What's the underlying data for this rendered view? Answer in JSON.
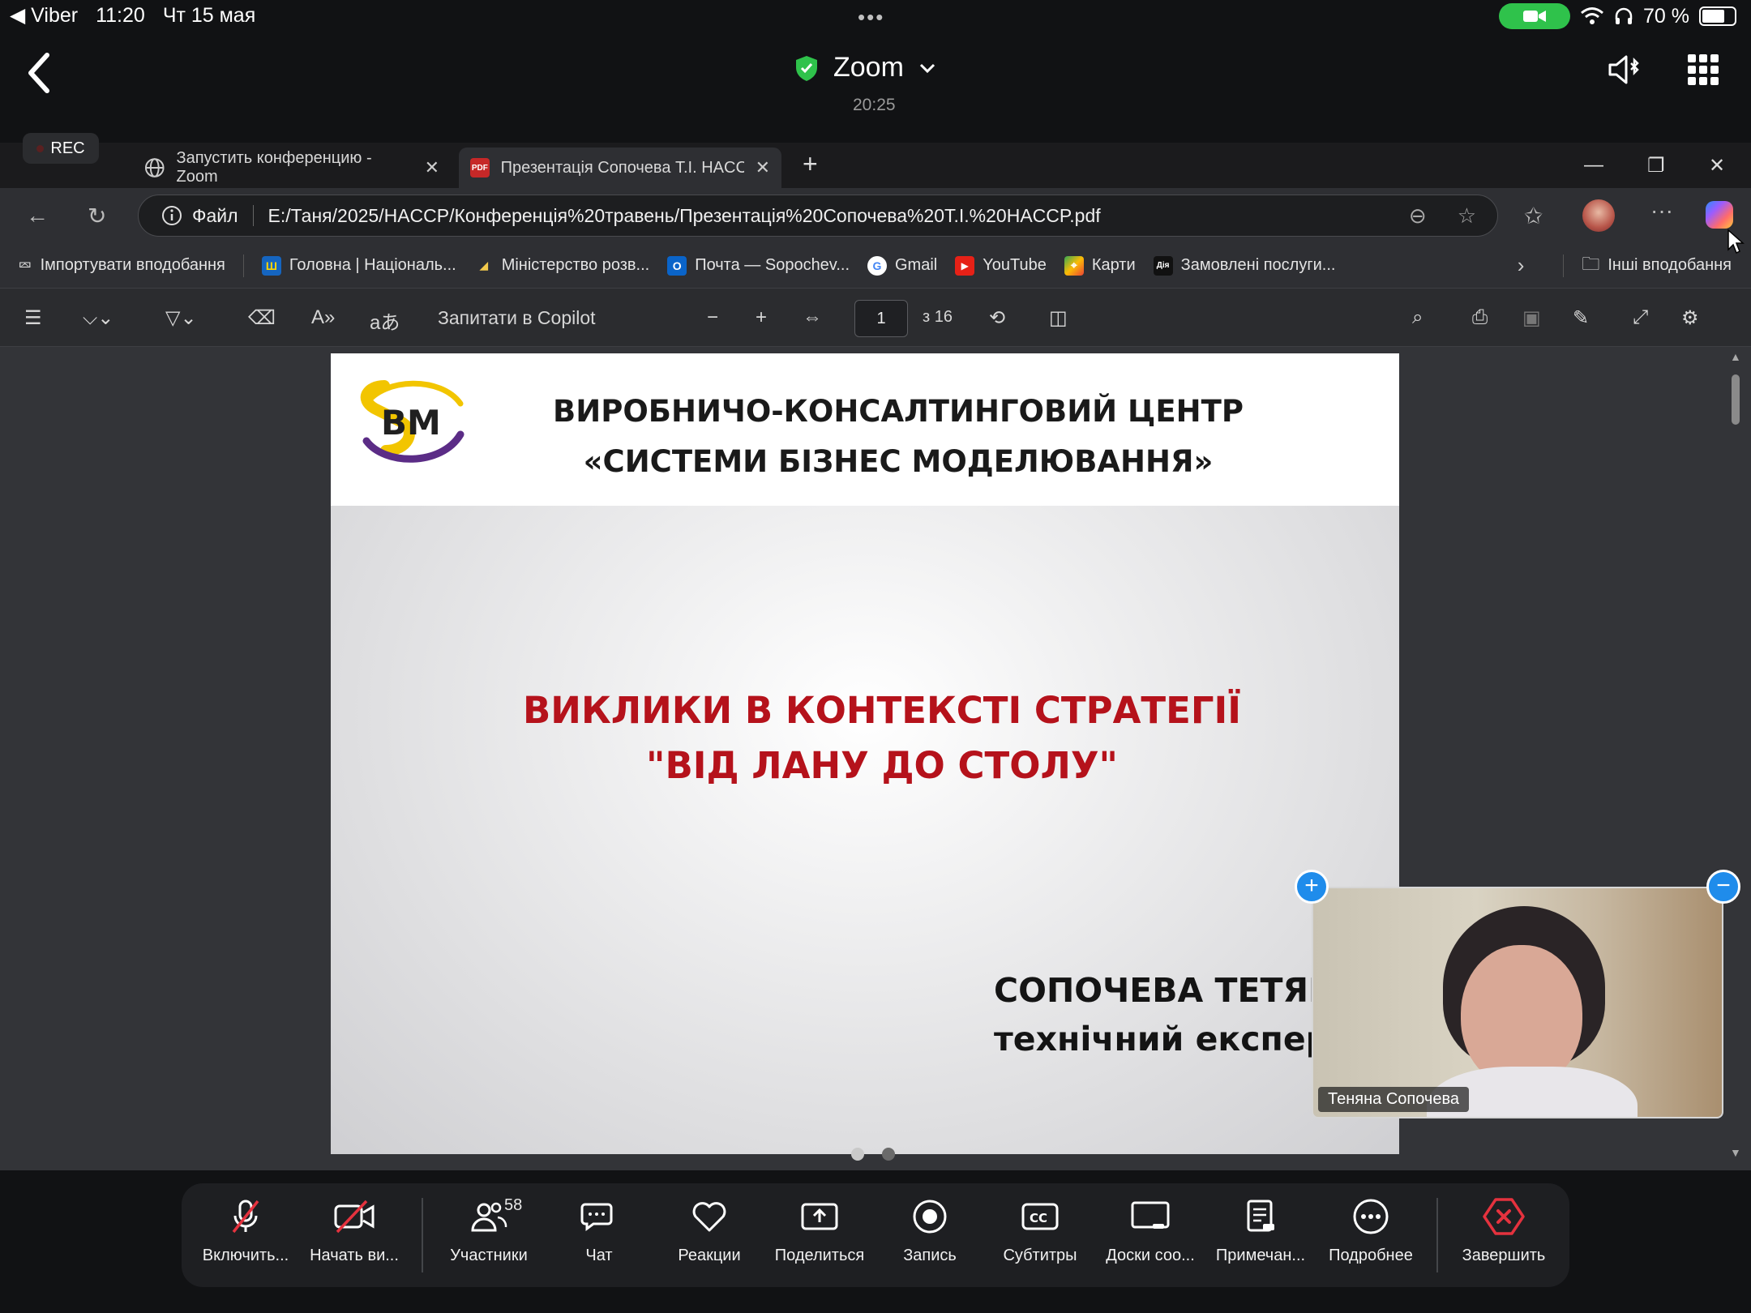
{
  "status_bar": {
    "back_app": "◀ Viber",
    "time": "11:20",
    "date": "Чт 15 мая",
    "battery": "70 %"
  },
  "zoom": {
    "title": "Zoom",
    "meeting_time": "20:25"
  },
  "browser": {
    "rec_label": "REC",
    "tabs": [
      {
        "label": "Запустить конференцию - Zoom"
      },
      {
        "label": "Презентація Сопочева Т.І. HACC"
      }
    ],
    "address": {
      "scheme_label": "Файл",
      "url": "E:/Таня/2025/HACCP/Конференція%20травень/Презентація%20Сопочева%20Т.І.%20HACCP.pdf"
    },
    "bookmarks": [
      {
        "label": "Імпортувати вподобання"
      },
      {
        "label": "Головна | Національ..."
      },
      {
        "label": "Міністерство розв..."
      },
      {
        "label": "Почта — Sopochev..."
      },
      {
        "label": "Gmail"
      },
      {
        "label": "YouTube"
      },
      {
        "label": "Карти"
      },
      {
        "label": "Замовлені послуги..."
      }
    ],
    "other_bookmarks": "Інші вподобання",
    "pdf_toolbar": {
      "copilot": "Запитати в Copilot",
      "page_current": "1",
      "page_total": "з 16"
    }
  },
  "slide": {
    "logo_text": "BM",
    "org_line1": "ВИРОБНИЧО-КОНСАЛТИНГОВИЙ ЦЕНТР",
    "org_line2": "«СИСТЕМИ БІЗНЕС МОДЕЛЮВАННЯ»",
    "title_line1": "ВИКЛИКИ В КОНТЕКСТІ СТРАТЕГІЇ",
    "title_line2": "\"ВІД ЛАНУ ДО СТОЛУ\"",
    "presenter_name": "СОПОЧЕВА ТЕТЯН",
    "presenter_role": "технічний експерт"
  },
  "video": {
    "participant_name": "Теняна Сопочева"
  },
  "controls": {
    "mic": "Включить...",
    "video": "Начать ви...",
    "participants": "Участники",
    "participants_count": "58",
    "chat": "Чат",
    "reactions": "Реакции",
    "share": "Поделиться",
    "record": "Запись",
    "captions": "Субтитры",
    "whiteboards": "Доски соо...",
    "notes": "Примечан...",
    "more": "Подробнее",
    "end": "Завершить"
  },
  "colors": {
    "accent_blue": "#1f8ceb",
    "end_red": "#e5323e",
    "slide_title_red": "#b5121b",
    "shield_green": "#2fc24b"
  }
}
